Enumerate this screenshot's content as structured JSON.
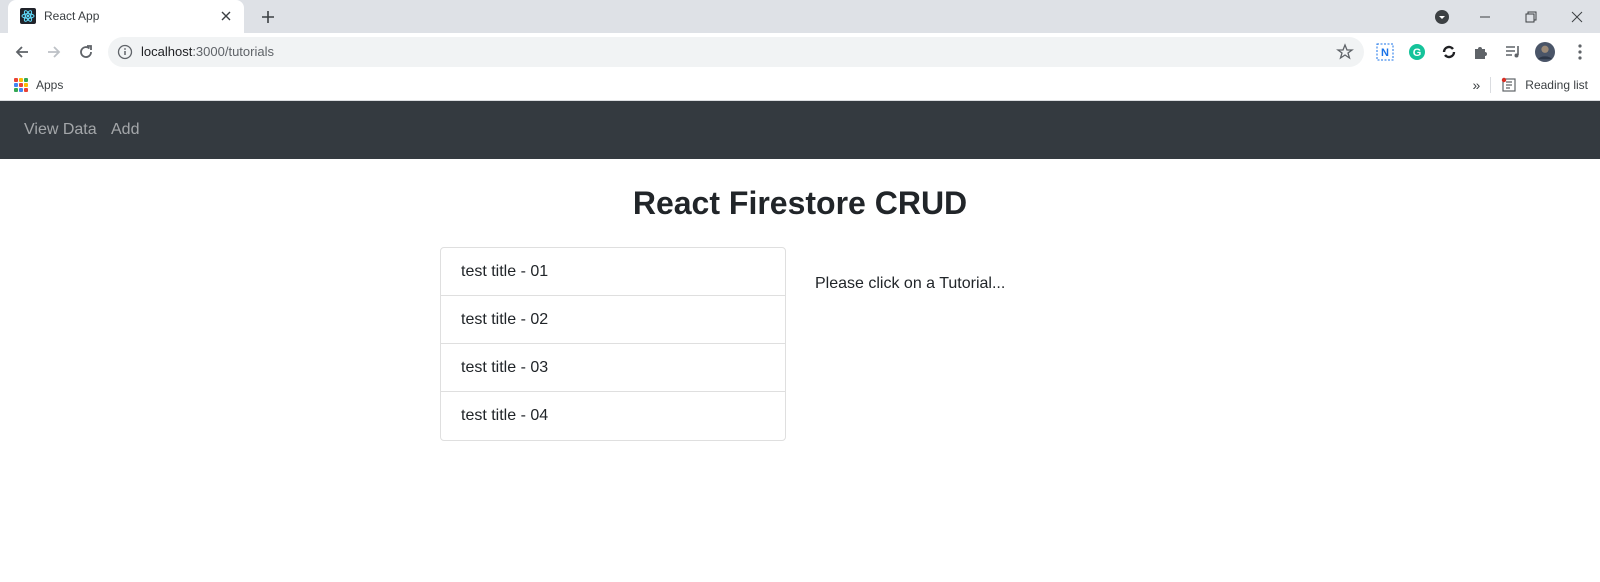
{
  "browser": {
    "tab_title": "React App",
    "url_host": "localhost",
    "url_rest": ":3000/tutorials",
    "bookmarks": {
      "apps_label": "Apps",
      "reading_list_label": "Reading list",
      "overflow_label": "»"
    }
  },
  "app_nav": {
    "items": [
      "View Data",
      "Add"
    ]
  },
  "main": {
    "title": "React Firestore CRUD",
    "tutorials": [
      "test title - 01",
      "test title - 02",
      "test title - 03",
      "test title - 04"
    ],
    "hint": "Please click on a Tutorial..."
  },
  "colors": {
    "navbar": "#343a40",
    "nav_link": "rgba(255,255,255,0.55)",
    "text": "#212529"
  }
}
